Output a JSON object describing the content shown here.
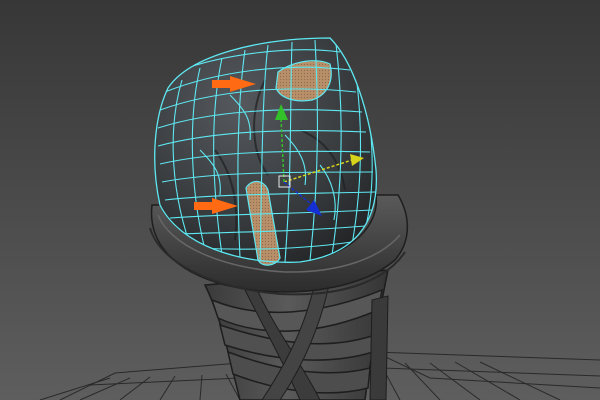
{
  "viewport": {
    "background_top": "#373737",
    "background_bottom": "#5e5e5e",
    "grid_color": "#2a2a2a"
  },
  "mesh": {
    "wire_color": "#5ee8f2",
    "skin_color": "#3a3d40",
    "cone_color": "#4d4d4d"
  },
  "selection": {
    "face_color": "#b88f68",
    "marker_color": "#ff6a12"
  },
  "manipulator": {
    "x_axis_color": "#d8d41a",
    "y_axis_color": "#33c12a",
    "z_axis_color": "#1530d2",
    "icons": [
      "move-tool-icon"
    ]
  }
}
